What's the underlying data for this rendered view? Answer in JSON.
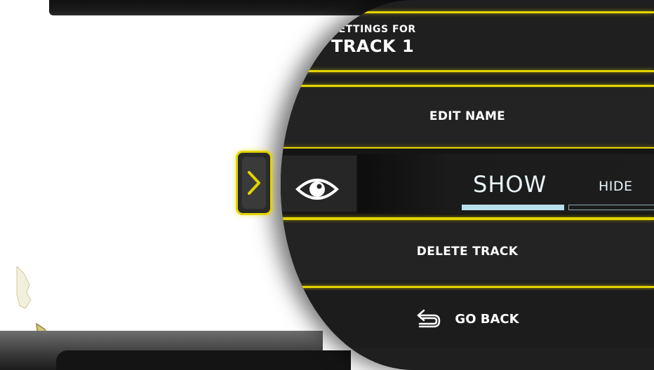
{
  "header": {
    "subtitle": "SETTINGS FOR",
    "title": "TRACK 1"
  },
  "menu": {
    "edit_name": "EDIT NAME",
    "delete_track": "DELETE TRACK",
    "go_back": "GO BACK"
  },
  "visibility": {
    "show_label": "SHOW",
    "hide_label": "HIDE",
    "selected": "SHOW",
    "icon": "eye-icon"
  },
  "side_tab": {
    "icon": "chevron-right-icon"
  },
  "colors": {
    "accent": "#e3d400",
    "panel": "#1f1f1f",
    "text": "#ffffff",
    "selection_bar": "#b8e0ec"
  }
}
